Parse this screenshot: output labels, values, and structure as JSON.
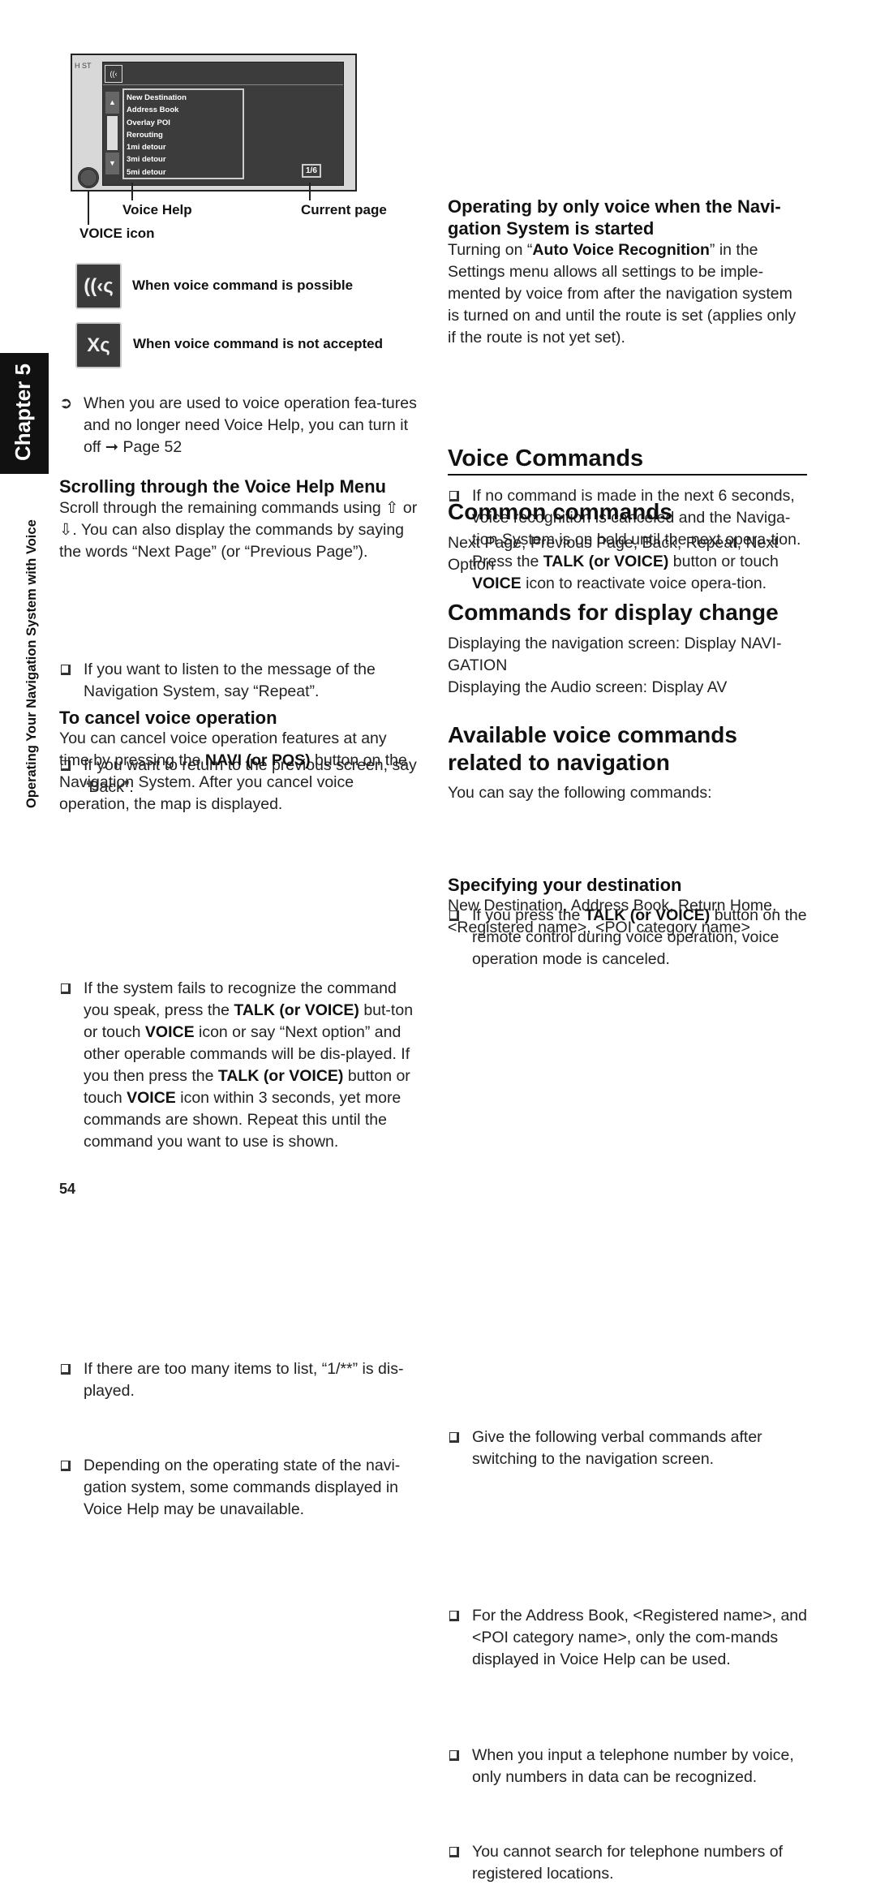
{
  "sidebar": {
    "chapter": "Chapter 5",
    "section": "Operating Your Navigation System with Voice"
  },
  "figure": {
    "map_label": "H ST",
    "voice_help_items": [
      "New Destination",
      "Address Book",
      "Overlay POI",
      "Rerouting",
      "1mi detour",
      "3mi detour",
      "5mi detour"
    ],
    "page_indicator": "1/6",
    "callouts": {
      "voice_help": "Voice Help",
      "current_page": "Current page",
      "voice_icon": "VOICE icon"
    }
  },
  "icons": {
    "possible": {
      "icon": "voice-possible-icon",
      "label": "When voice command is possible"
    },
    "not_accepted": {
      "icon": "voice-not-accepted-icon",
      "label": "When voice command is not accepted"
    }
  },
  "left": {
    "note": [
      "When you are used to voice operation fea-tures and no longer need Voice Help, you can turn it off ",
      "➞",
      " Page 52"
    ],
    "scroll_heading": "Scrolling through the Voice Help Menu",
    "scroll_para": {
      "a": "Scroll through the remaining commands using ",
      "or": " or ",
      "b": ". You can also display the commands by saying the words “Next Page” (or “Previous Page”)."
    },
    "scroll_bullets": [
      [
        [
          "If you want to listen to the message of the Navigation System, say “Repeat”.",
          0
        ]
      ],
      [
        [
          "If you want to return to the previous screen, say “Back”.",
          0
        ]
      ]
    ],
    "cancel_heading": "To cancel voice operation",
    "cancel_para": [
      [
        "You can cancel voice operation features at any time by pressing the ",
        0
      ],
      [
        "NAVI (or POS)",
        1
      ],
      [
        " button on the Navigation System. After you cancel voice operation, the map is displayed.",
        0
      ]
    ],
    "cancel_bullets": [
      [
        [
          "If the system fails to recognize the command you speak, press the ",
          0
        ],
        [
          "TALK (or VOICE)",
          1
        ],
        [
          " but-ton or touch ",
          0
        ],
        [
          "VOICE",
          1
        ],
        [
          " icon or say “Next option” and other operable commands will be dis-played. If you then press the ",
          0
        ],
        [
          "TALK (or VOICE)",
          1
        ],
        [
          " button or touch ",
          0
        ],
        [
          "VOICE",
          1
        ],
        [
          " icon within 3 seconds, yet more commands are shown. Repeat this until the command you want to use is shown.",
          0
        ]
      ],
      [
        [
          "If there are too many items to list, “1/**” is dis-played.",
          0
        ]
      ],
      [
        [
          "Depending on the operating state of the navi-gation system, some commands displayed in Voice Help may be unavailable.",
          0
        ]
      ]
    ],
    "page_number": "54"
  },
  "right": {
    "bullet_top": [
      [
        "If no command is made in the next 6 seconds, voice recognition is canceled and the Naviga-tion System is on hold until the next opera-tion. Press the ",
        0
      ],
      [
        "TALK (or VOICE)",
        1
      ],
      [
        " button or touch ",
        0
      ],
      [
        "VOICE",
        1
      ],
      [
        " icon to reactivate voice opera-tion.",
        0
      ]
    ],
    "start_heading": "Operating by only voice when the Navi-gation System is started",
    "start_para": [
      [
        "Turning on “",
        0
      ],
      [
        "Auto Voice Recognition",
        1
      ],
      [
        "” in the Settings menu allows all settings to be imple-mented by voice from after the navigation system is turned on and until the route is set (applies only if the route is not yet set).",
        0
      ]
    ],
    "start_bullet": [
      [
        "If you press the ",
        0
      ],
      [
        "TALK (or VOICE)",
        1
      ],
      [
        " button on the remote control during voice operation, voice operation mode is canceled.",
        0
      ]
    ],
    "voice_commands_title": "Voice Commands",
    "common_heading": "Common commands",
    "common_para": "Next Page, Previous Page, Back, Repeat, Next Option",
    "display_heading": "Commands for display change",
    "display_para1": "Displaying the navigation screen: Display NAVI-GATION",
    "display_para2": "Displaying the Audio screen: Display AV",
    "nav_heading": "Available voice commands related to navigation",
    "nav_para": "You can say the following commands:",
    "nav_bullet": [
      [
        "Give the following verbal commands after switching to the navigation screen.",
        0
      ]
    ],
    "dest_heading": "Specifying your destination",
    "dest_para": "New Destination, Address Book, Return Home, <Registered name>, <POI category name>",
    "dest_bullets": [
      [
        [
          "For the Address Book, <Registered name>, and <POI category name>, only the com-mands displayed in Voice Help can be used.",
          0
        ]
      ],
      [
        [
          "When you input a telephone number by voice, only numbers in data can be recognized.",
          0
        ]
      ],
      [
        [
          "You cannot search for telephone numbers of registered locations.",
          0
        ]
      ]
    ]
  }
}
